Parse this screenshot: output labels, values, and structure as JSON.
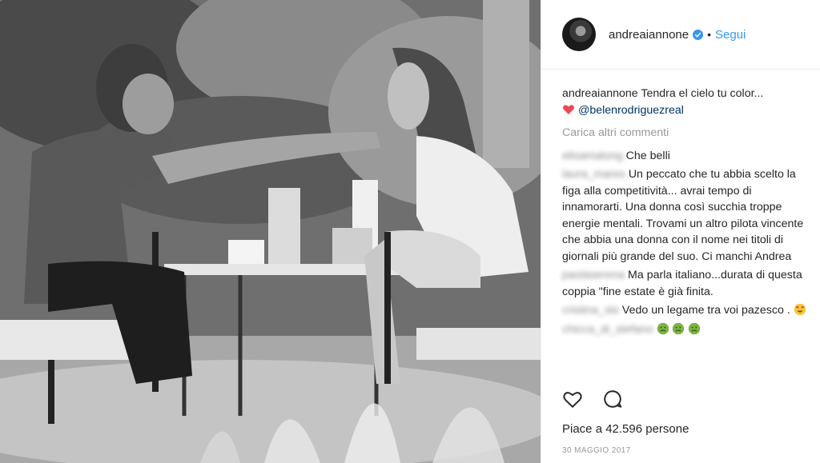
{
  "header": {
    "username": "andreaiannone",
    "dot": "•",
    "follow_label": "Segui"
  },
  "caption": {
    "username": "andreaiannone",
    "text": "Tendra el cielo tu color...",
    "mention": "@belenrodriguezreal"
  },
  "load_more_label": "Carica altri commenti",
  "comments": [
    {
      "user": "elisamalong",
      "text": "Che belli"
    },
    {
      "user": "laura_mares",
      "text": "Un peccato che tu abbia scelto la figa alla competitività... avrai tempo di innamorarti. Una donna così succhia troppe energie mentali. Trovami un altro pilota vincente che abbia una donna con il nome nei titoli di giornali più grande del suo. Ci manchi Andrea"
    },
    {
      "user": "paolaserena",
      "text": "Ma parla italiano...durata di questa  coppia \"fine estate è già finita."
    },
    {
      "user": "cristina_sts",
      "text": "Vedo un legame tra voi pazesco ."
    },
    {
      "user": "chicca_di_stefano",
      "text": ""
    }
  ],
  "likes_text": "Piace a 42.596 persone",
  "date_text": "30 MAGGIO 2017",
  "colors": {
    "link_blue": "#3897f0",
    "mention_blue": "#003569",
    "muted": "#999999",
    "heart_red": "#ed4956"
  },
  "icons": [
    "verified-icon",
    "heart-emoji-icon",
    "heart-eyes-emoji-icon",
    "sick-emoji-icon",
    "like-icon",
    "comment-icon"
  ]
}
